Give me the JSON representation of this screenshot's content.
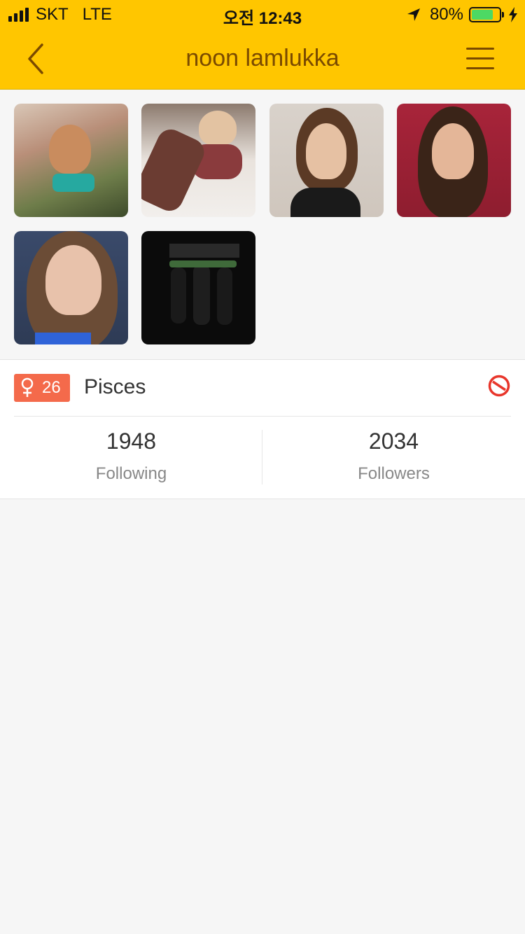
{
  "status_bar": {
    "carrier": "SKT",
    "network": "LTE",
    "time": "오전 12:43",
    "battery_percent": "80%",
    "battery_level": 0.8
  },
  "nav": {
    "title": "noon lamlukka",
    "back_icon": "chevron-left-icon",
    "menu_icon": "hamburger-menu-icon"
  },
  "photos": [
    {
      "name": "photo-1"
    },
    {
      "name": "photo-2"
    },
    {
      "name": "photo-3"
    },
    {
      "name": "photo-4"
    },
    {
      "name": "photo-5"
    },
    {
      "name": "photo-6"
    }
  ],
  "profile": {
    "gender_icon": "female-icon",
    "age": "26",
    "zodiac": "Pisces",
    "block_icon": "block-icon",
    "badge_color": "#f46a4b"
  },
  "stats": {
    "following_count": "1948",
    "following_label": "Following",
    "followers_count": "2034",
    "followers_label": "Followers"
  },
  "colors": {
    "header": "#ffc600",
    "title": "#7a4a00",
    "block": "#e8362b"
  }
}
